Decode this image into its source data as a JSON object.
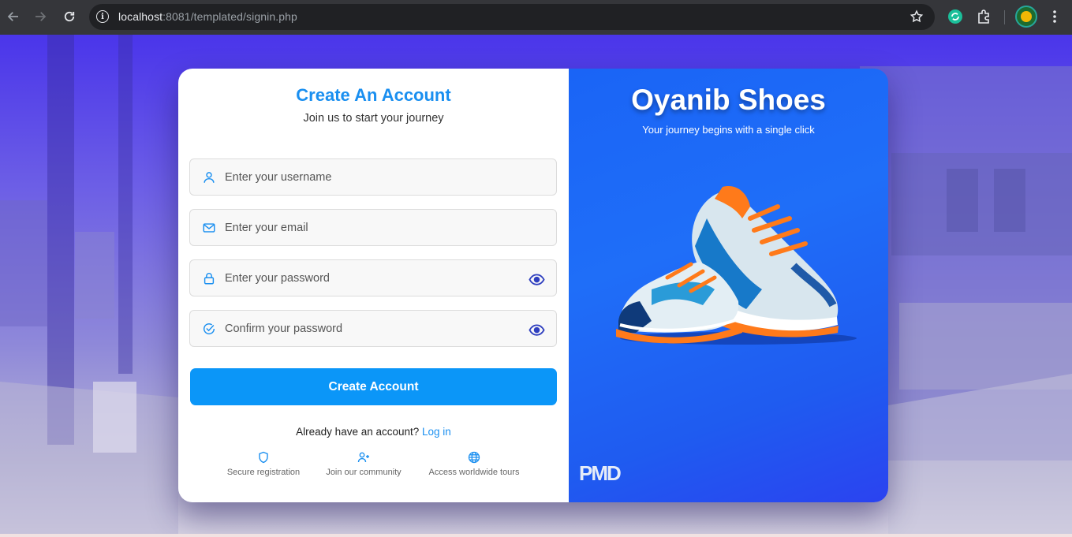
{
  "browser": {
    "url_host": "localhost",
    "url_rest": ":8081/templated/signin.php",
    "back_icon": "back-arrow-icon",
    "forward_icon": "forward-arrow-icon",
    "reload_icon": "reload-icon"
  },
  "form": {
    "title": "Create An Account",
    "subtitle": "Join us to start your journey",
    "username_placeholder": "Enter your username",
    "email_placeholder": "Enter your email",
    "password_placeholder": "Enter your password",
    "confirm_placeholder": "Confirm your password",
    "submit_label": "Create Account",
    "already_text": "Already have an account?",
    "login_link": "Log in",
    "features": [
      {
        "icon": "shield-icon",
        "label": "Secure registration"
      },
      {
        "icon": "user-plus-icon",
        "label": "Join our community"
      },
      {
        "icon": "globe-icon",
        "label": "Access worldwide tours"
      }
    ]
  },
  "brand": {
    "title": "Oyanib Shoes",
    "tagline": "Your journey begins with a single click",
    "accent": "#1a8ff0",
    "panel_color": "#1f6ef8"
  }
}
